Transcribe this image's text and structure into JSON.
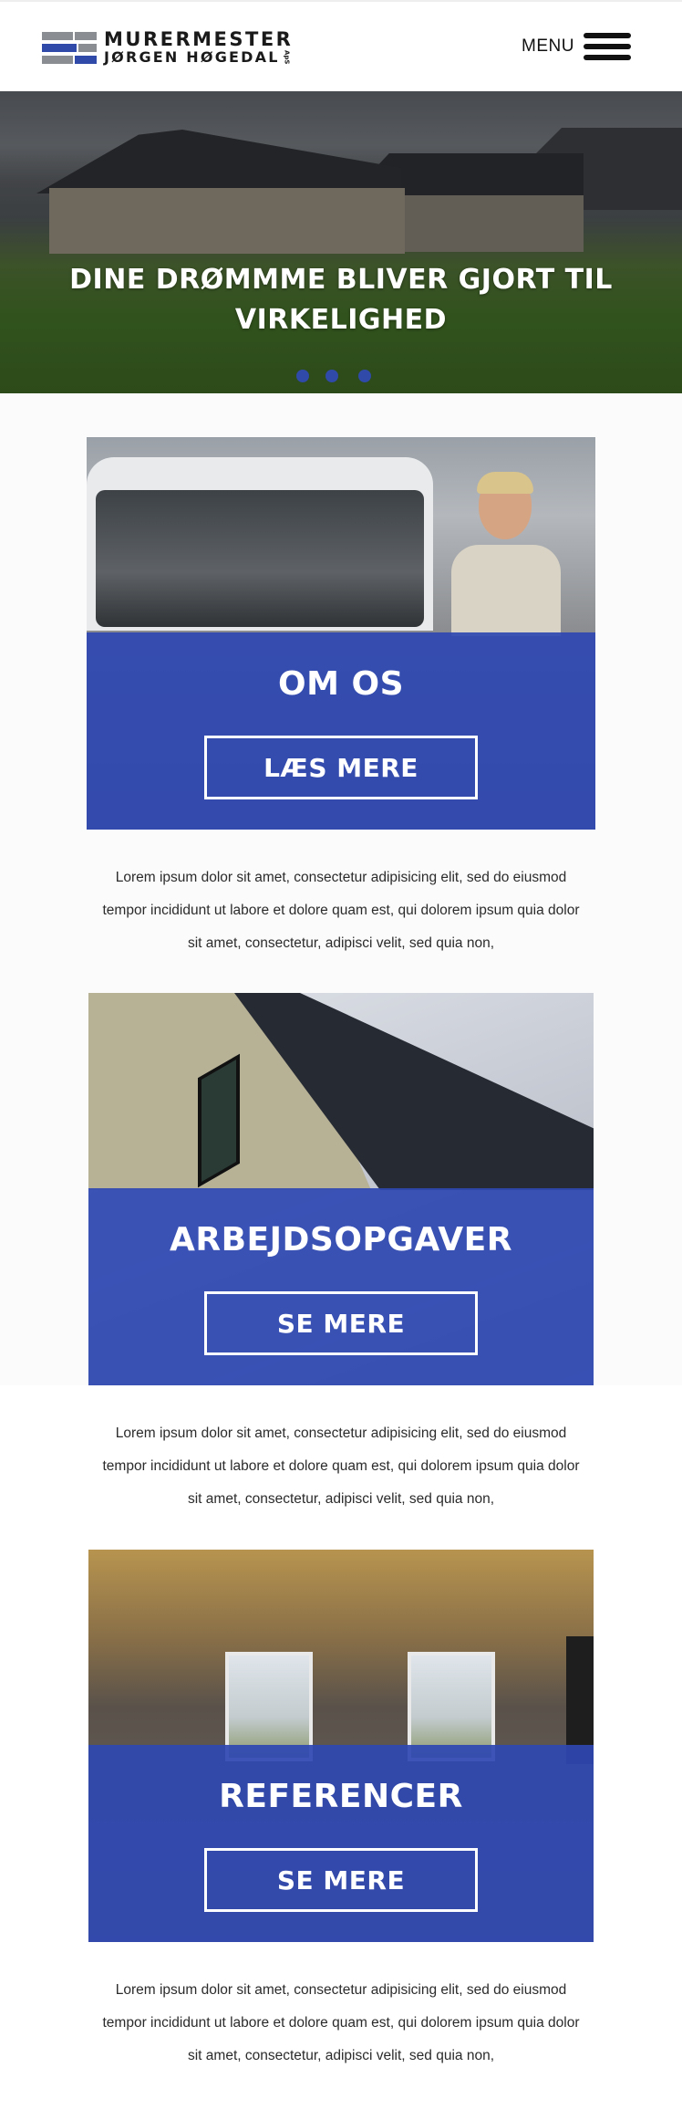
{
  "header": {
    "logo": {
      "line1": "MURERMESTER",
      "line2": "JØRGEN HØGEDAL",
      "suffix": "ApS"
    },
    "menu_label": "MENU"
  },
  "hero": {
    "title_line1": "DINE DRØMMME BLIVER GJORT TIL",
    "title_line2": "VIRKELIGHED",
    "slide_count": 3
  },
  "sections": [
    {
      "title": "OM OS",
      "button_label": "LÆS MERE",
      "description_line1": "Lorem ipsum dolor sit amet, consectetur adipisicing elit, sed do eiusmod",
      "description_line2": "tempor incididunt ut labore et dolore quam est, qui dolorem ipsum quia dolor",
      "description_line3": "sit amet, consectetur, adipisci velit, sed quia non,"
    },
    {
      "title": "ARBEJDSOPGAVER",
      "button_label": "SE MERE",
      "description_line1": "Lorem ipsum dolor sit amet, consectetur adipisicing elit, sed do eiusmod",
      "description_line2": "tempor incididunt ut labore et dolore quam est, qui dolorem ipsum quia dolor",
      "description_line3": "sit amet, consectetur, adipisci velit, sed quia non,"
    },
    {
      "title": "REFERENCER",
      "button_label": "SE MERE",
      "description_line1": "Lorem ipsum dolor sit amet, consectetur adipisicing elit, sed do eiusmod",
      "description_line2": "tempor incididunt ut labore et dolore quam est, qui dolorem ipsum quia dolor",
      "description_line3": "sit amet, consectetur, adipisci velit, sed quia non,"
    }
  ],
  "colors": {
    "brand_blue": "#2f4aa8",
    "brand_grey": "#8a8d92"
  }
}
